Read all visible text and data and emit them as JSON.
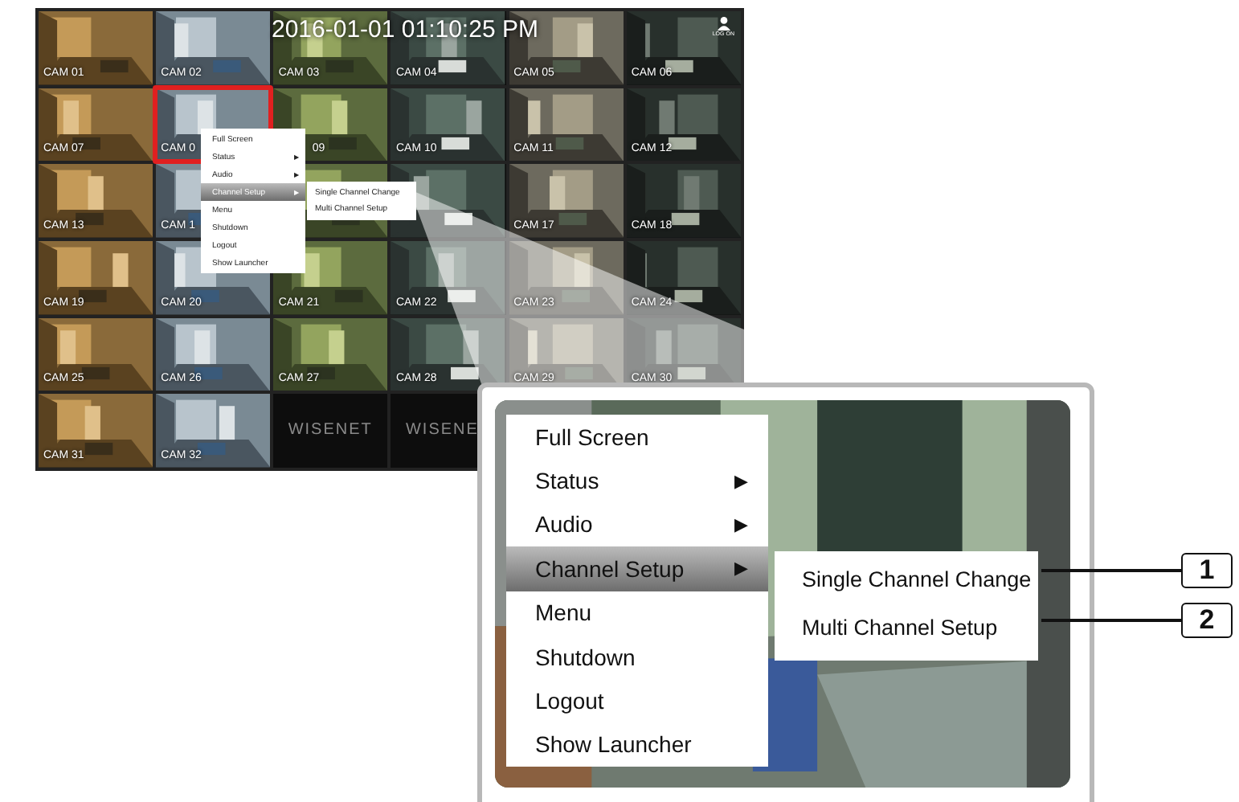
{
  "timestamp": "2016-01-01 01:10:25 PM",
  "user_badge": "LOG ON",
  "cameras": [
    {
      "kind": "camera",
      "label": "CAM 01",
      "selected": false
    },
    {
      "kind": "camera",
      "label": "CAM 02",
      "selected": false
    },
    {
      "kind": "camera",
      "label": "CAM 03",
      "selected": false
    },
    {
      "kind": "camera",
      "label": "CAM 04",
      "selected": false
    },
    {
      "kind": "camera",
      "label": "CAM 05",
      "selected": false
    },
    {
      "kind": "camera",
      "label": "CAM 06",
      "selected": false,
      "user_icon": true
    },
    {
      "kind": "camera",
      "label": "CAM 07",
      "selected": false
    },
    {
      "kind": "camera",
      "label": "CAM 0",
      "selected": true
    },
    {
      "kind": "camera",
      "label": "09",
      "selected": false
    },
    {
      "kind": "camera",
      "label": "CAM 10",
      "selected": false
    },
    {
      "kind": "camera",
      "label": "CAM 11",
      "selected": false
    },
    {
      "kind": "camera",
      "label": "CAM 12",
      "selected": false
    },
    {
      "kind": "camera",
      "label": "CAM 13",
      "selected": false
    },
    {
      "kind": "camera",
      "label": "CAM 1",
      "selected": false
    },
    {
      "kind": "camera",
      "selected": false
    },
    {
      "kind": "camera",
      "selected": false
    },
    {
      "kind": "camera",
      "label": "CAM 17",
      "selected": false
    },
    {
      "kind": "camera",
      "label": "CAM 18",
      "selected": false
    },
    {
      "kind": "camera",
      "label": "CAM 19",
      "selected": false
    },
    {
      "kind": "camera",
      "label": "CAM 20",
      "selected": false
    },
    {
      "kind": "camera",
      "label": "CAM 21",
      "selected": false
    },
    {
      "kind": "camera",
      "label": "CAM 22",
      "selected": false
    },
    {
      "kind": "camera",
      "label": "CAM 23",
      "selected": false
    },
    {
      "kind": "camera",
      "label": "CAM 24",
      "selected": false
    },
    {
      "kind": "camera",
      "label": "CAM 25",
      "selected": false
    },
    {
      "kind": "camera",
      "label": "CAM 26",
      "selected": false
    },
    {
      "kind": "camera",
      "label": "CAM 27",
      "selected": false
    },
    {
      "kind": "camera",
      "label": "CAM 28",
      "selected": false
    },
    {
      "kind": "camera",
      "label": "CAM 29",
      "selected": false
    },
    {
      "kind": "camera",
      "label": "CAM 30",
      "selected": false
    },
    {
      "kind": "camera",
      "label": "CAM 31",
      "selected": false
    },
    {
      "kind": "camera",
      "label": "CAM 32",
      "selected": false
    },
    {
      "kind": "logo",
      "label": "WISENET",
      "selected": false
    },
    {
      "kind": "logo",
      "label": "WISENE",
      "selected": false
    }
  ],
  "context_menu": {
    "items": [
      {
        "label": "Full Screen",
        "selected": false
      },
      {
        "label": "Status",
        "arrow": "▶",
        "selected": false
      },
      {
        "label": "Audio",
        "arrow": "▶",
        "selected": false
      },
      {
        "label": "Channel Setup",
        "arrow": "▶",
        "selected": true
      },
      {
        "label": "Menu",
        "selected": false
      },
      {
        "label": "Shutdown",
        "selected": false
      },
      {
        "label": "Logout",
        "selected": false
      },
      {
        "label": "Show Launcher",
        "selected": false
      }
    ],
    "submenu": [
      "Single Channel Change",
      "Multi Channel Setup"
    ]
  },
  "zoom_callout": {
    "menu": [
      {
        "label": "Full Screen",
        "selected": false
      },
      {
        "label": "Status",
        "arrow": "▶",
        "selected": false
      },
      {
        "label": "Audio",
        "arrow": "▶",
        "selected": false
      },
      {
        "label": "Channel Setup",
        "arrow": "▶",
        "selected": true
      },
      {
        "label": "Menu",
        "selected": false
      },
      {
        "label": "Shutdown",
        "selected": false
      },
      {
        "label": "Logout",
        "selected": false
      },
      {
        "label": "Show Launcher",
        "selected": false
      }
    ],
    "submenu": [
      {
        "label": "Single Channel Change",
        "number": "1"
      },
      {
        "label": "Multi Channel Setup",
        "number": "2"
      }
    ]
  }
}
